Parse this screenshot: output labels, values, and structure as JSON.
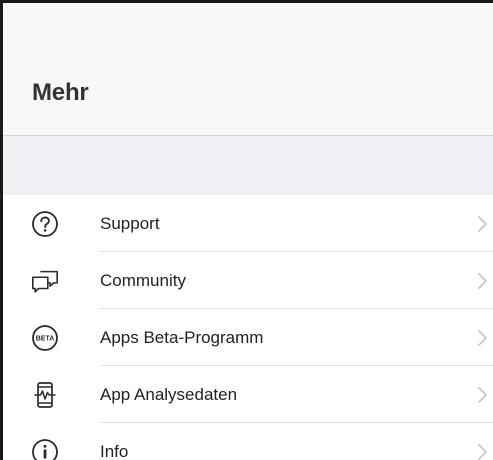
{
  "header": {
    "title": "Mehr"
  },
  "menu": {
    "items": [
      {
        "label": "Support",
        "icon": "question-circle-icon"
      },
      {
        "label": "Community",
        "icon": "chat-bubbles-icon"
      },
      {
        "label": "Apps Beta-Programm",
        "icon": "beta-badge-icon",
        "badge": "BETA"
      },
      {
        "label": "App Analysedaten",
        "icon": "device-analytics-icon"
      },
      {
        "label": "Info",
        "icon": "info-circle-icon"
      }
    ]
  },
  "colors": {
    "header_bg": "#f8f8f8",
    "section_bg": "#efeff4",
    "text": "#222222",
    "icon": "#2b2b2b",
    "chevron": "#c7c7cc",
    "separator": "#e2e2e2"
  }
}
